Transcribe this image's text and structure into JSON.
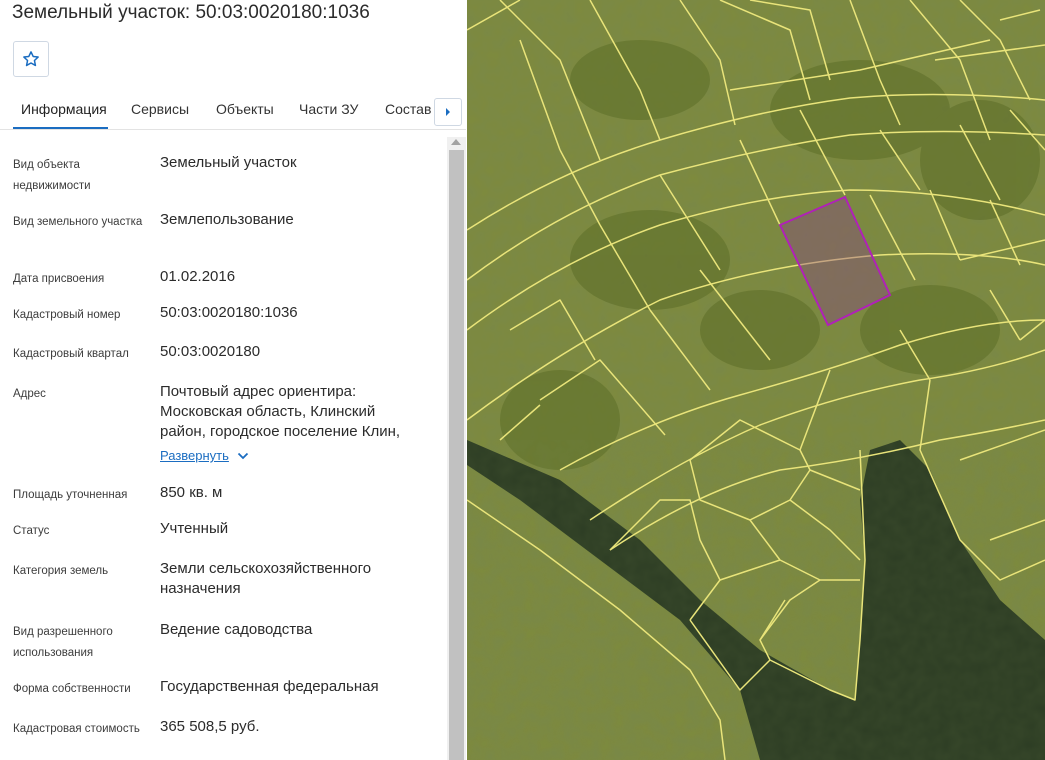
{
  "header": {
    "title": "Земельный участок: 50:03:0020180:1036"
  },
  "favorite": {
    "icon": "star-outline-icon"
  },
  "tabs": [
    {
      "label": "Информация",
      "active": true
    },
    {
      "label": "Сервисы"
    },
    {
      "label": "Объекты"
    },
    {
      "label": "Части ЗУ"
    },
    {
      "label": "Состав"
    }
  ],
  "properties": [
    {
      "label": "Вид объекта недвижимости",
      "value": "Земельный участок"
    },
    {
      "label": "Вид земельного участка",
      "value": "Землепользование"
    },
    {
      "label": "Дата присвоения",
      "value": "01.02.2016"
    },
    {
      "label": "Кадастровый номер",
      "value": "50:03:0020180:1036"
    },
    {
      "label": "Кадастровый квартал",
      "value": "50:03:0020180"
    },
    {
      "label": "Адрес",
      "value": "Почтовый адрес ориентира: Московская область, Клинский район, городское поселение Клин,",
      "link": "Развернуть"
    },
    {
      "label": "Площадь уточненная",
      "value": "850 кв. м"
    },
    {
      "label": "Статус",
      "value": "Учтенный"
    },
    {
      "label": "Категория земель",
      "value": "Земли сельскохозяйственного назначения"
    },
    {
      "label": "Вид разрешенного использования",
      "value": "Ведение садоводства"
    },
    {
      "label": "Форма собственности",
      "value": "Государственная федеральная"
    },
    {
      "label": "Кадастровая стоимость",
      "value": "365 508,5 руб."
    }
  ],
  "colors": {
    "accent": "#1b6dc1",
    "parcel_border": "#e9e47a",
    "selected_parcel": "#b021b8",
    "grass": "#7e8a3c",
    "forest": "#2d3d24"
  }
}
